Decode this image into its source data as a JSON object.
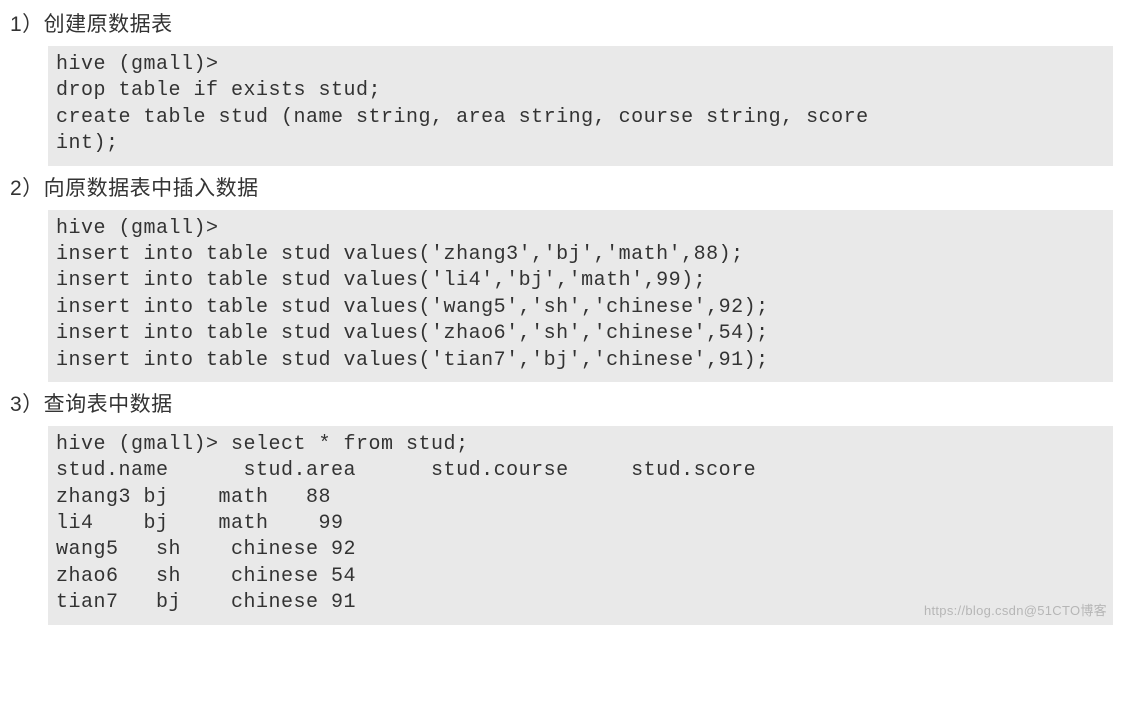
{
  "sections": [
    {
      "title": "1）创建原数据表",
      "code": "hive (gmall)>\ndrop table if exists stud;\ncreate table stud (name string, area string, course string, score\nint);"
    },
    {
      "title": "2）向原数据表中插入数据",
      "code": "hive (gmall)>\ninsert into table stud values('zhang3','bj','math',88);\ninsert into table stud values('li4','bj','math',99);\ninsert into table stud values('wang5','sh','chinese',92);\ninsert into table stud values('zhao6','sh','chinese',54);\ninsert into table stud values('tian7','bj','chinese',91);"
    },
    {
      "title": "3）查询表中数据",
      "code": "hive (gmall)> select * from stud;\nstud.name      stud.area      stud.course     stud.score\nzhang3 bj    math   88\nli4    bj    math    99\nwang5   sh    chinese 92\nzhao6   sh    chinese 54\ntian7   bj    chinese 91"
    }
  ],
  "watermark": "https://blog.csdn@51CTO博客"
}
